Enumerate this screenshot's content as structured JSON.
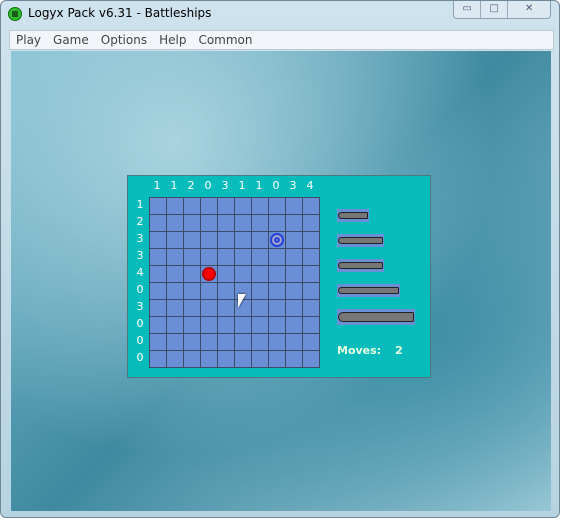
{
  "window": {
    "title": "Logyx Pack v6.31 - Battleships",
    "controls": [
      "minimize",
      "maximize",
      "close"
    ]
  },
  "menu": [
    "Play",
    "Game",
    "Options",
    "Help",
    "Common"
  ],
  "game": {
    "column_counts": [
      "1",
      "1",
      "2",
      "0",
      "3",
      "1",
      "1",
      "0",
      "3",
      "4"
    ],
    "row_counts": [
      "1",
      "2",
      "3",
      "3",
      "4",
      "0",
      "3",
      "0",
      "0",
      "0"
    ],
    "grid_size": 10,
    "hits": [
      {
        "row": 4,
        "col": 3
      }
    ],
    "misses": [
      {
        "row": 2,
        "col": 7
      }
    ],
    "ships": [
      "patrol-boat",
      "submarine",
      "destroyer",
      "battleship",
      "aircraft-carrier"
    ],
    "moves_label": "Moves:",
    "moves": "2"
  },
  "colors": {
    "panel": "#08bcbc",
    "grid": "#6a8fd6",
    "hit": "#ff0000",
    "miss": "#2a44d8"
  }
}
